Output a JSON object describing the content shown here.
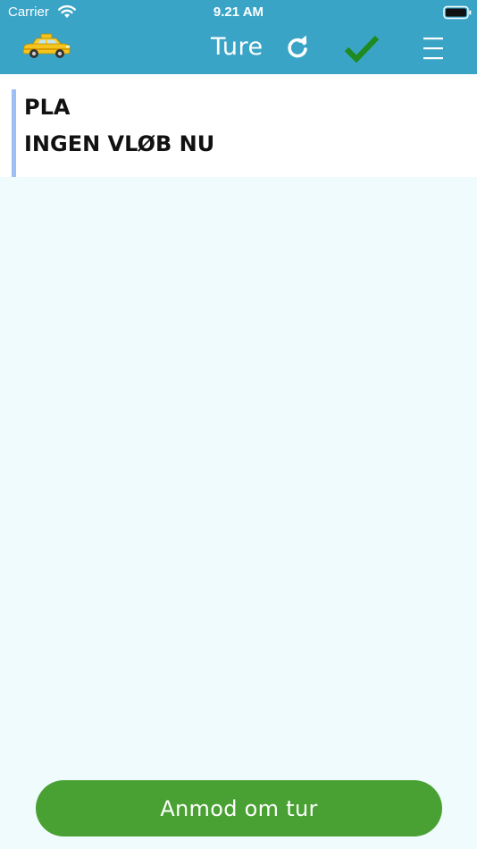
{
  "status_bar": {
    "carrier": "Carrier",
    "time": "9.21 AM"
  },
  "header": {
    "title": "Ture",
    "icons": {
      "logo": "taxi-icon",
      "refresh": "refresh-icon",
      "confirm": "checkmark-icon",
      "menu": "hamburger-menu-icon"
    }
  },
  "trip_card": {
    "line1": "PLA",
    "line2": "INGEN VLØB NU"
  },
  "actions": {
    "request_label": "Anmod om tur"
  },
  "colors": {
    "header_bg": "#3aa4c6",
    "checkmark": "#1f8a1f",
    "button_bg": "#4aa133",
    "card_accent": "#9cc0f3",
    "page_bg": "#f0fbfd"
  }
}
